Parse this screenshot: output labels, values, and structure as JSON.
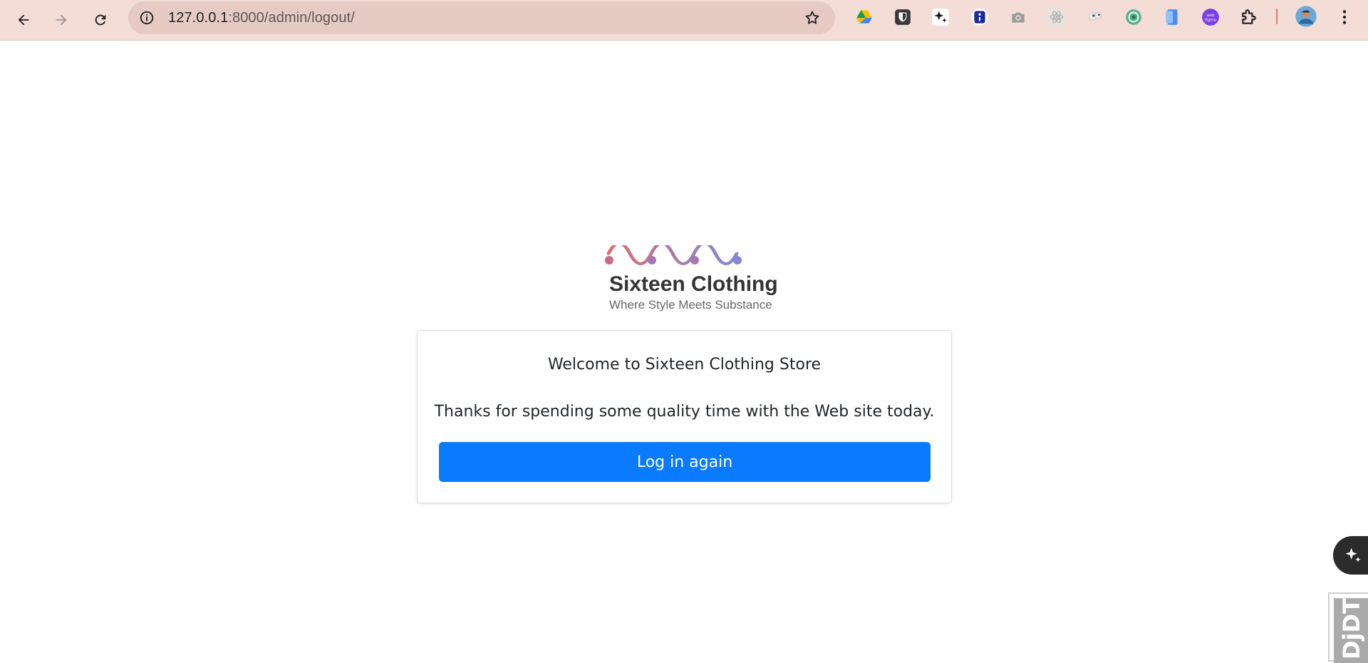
{
  "browser": {
    "url_host": "127.0.0.1",
    "url_path": ":8000/admin/logout/",
    "extensions": [
      "google-drive-icon",
      "bitwarden-icon",
      "sparkle-icon",
      "semicolon-extension-icon",
      "camera-icon",
      "react-devtools-icon",
      "eyes-extension-icon",
      "circular-extension-icon",
      "phone-extension-icon",
      "web-to-figma-icon",
      "puzzle-extensions-icon"
    ],
    "colors": {
      "toolbar": "#f3ddd6",
      "omnibox": "#e6cbc4"
    }
  },
  "brand": {
    "title": "Sixteen Clothing",
    "tagline": "Where Style Meets Substance"
  },
  "logout": {
    "welcome": "Welcome to Sixteen Clothing Store",
    "thanks": "Thanks for spending some quality time with the Web site today.",
    "login_again": "Log in again"
  },
  "debug_toolbar": {
    "handle_label_dj": "Dj",
    "handle_label_dt": "DT"
  },
  "colors": {
    "button": "#0a7bff",
    "wave_start": "#e06c6c",
    "wave_end": "#7a8ad8"
  }
}
